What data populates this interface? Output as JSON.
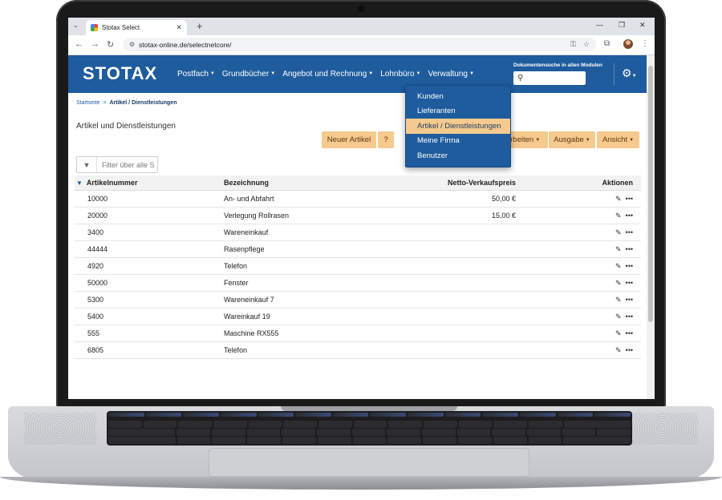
{
  "browser": {
    "tab_title": "Stotax Select",
    "url": "stotax-online.de/selectnetcore/"
  },
  "header": {
    "logo": "STOTAX",
    "menu": [
      "Postfach",
      "Grundbücher",
      "Angebot und Rechnung",
      "Lohnbüro",
      "Verwaltung"
    ],
    "doc_search_label": "Dokumentensuche in allen Modulen"
  },
  "breadcrumb": {
    "home": "Startseite",
    "sep": ">",
    "current": "Artikel / Dienstleistungen"
  },
  "page": {
    "title": "Artikel und Dienstleistungen"
  },
  "toolbar": {
    "new_article": "Neuer Artikel",
    "help": "?",
    "edit": "arbeiten",
    "output": "Ausgabe",
    "view": "Ansicht"
  },
  "filter": {
    "placeholder": "Filter über alle S"
  },
  "table": {
    "headers": [
      "Artikelnummer",
      "Bezeichnung",
      "Netto-Verkaufspreis",
      "Aktionen"
    ],
    "rows": [
      {
        "nr": "10000",
        "name": "An- und Abfahrt",
        "price": "50,00 €"
      },
      {
        "nr": "20000",
        "name": "Verlegung Rollrasen",
        "price": "15,00 €"
      },
      {
        "nr": "3400",
        "name": "Wareneinkauf",
        "price": ""
      },
      {
        "nr": "44444",
        "name": "Rasenpflege",
        "price": ""
      },
      {
        "nr": "4920",
        "name": "Telefon",
        "price": ""
      },
      {
        "nr": "50000",
        "name": "Fenster",
        "price": ""
      },
      {
        "nr": "5300",
        "name": "Wareneinkauf 7",
        "price": ""
      },
      {
        "nr": "5400",
        "name": "Wareinkauf 19",
        "price": ""
      },
      {
        "nr": "555",
        "name": "Maschine RX555",
        "price": ""
      },
      {
        "nr": "6805",
        "name": "Telefon",
        "price": ""
      }
    ]
  },
  "dropdown": {
    "items": [
      "Kunden",
      "Lieferanten",
      "Artikel / Dienstleistungen",
      "Meine Firma",
      "Benutzer"
    ],
    "active_index": 2
  },
  "colors": {
    "header_blue": "#1e5c9e",
    "button_orange": "#f6c98d"
  }
}
